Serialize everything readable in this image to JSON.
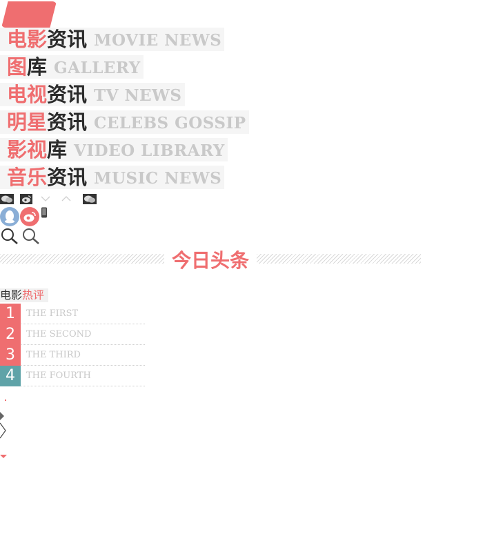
{
  "colors": {
    "accent": "#ef6e70",
    "dark": "#2a2a2a",
    "muted": "#c9c9c9",
    "teal": "#5fa3a8"
  },
  "nav": [
    {
      "cn_red": "电影",
      "cn_dark": "资讯",
      "en": "MOVIE NEWS"
    },
    {
      "cn_red": "图",
      "cn_dark": "库",
      "en": "GALLERY"
    },
    {
      "cn_red": "电视",
      "cn_dark": "资讯",
      "en": "TV NEWS"
    },
    {
      "cn_red": "明星",
      "cn_dark": "资讯",
      "en": "CELEBS GOSSIP"
    },
    {
      "cn_red": "影视",
      "cn_dark": "库",
      "en": "VIDEO LIBRARY"
    },
    {
      "cn_red": "音乐",
      "cn_dark": "资讯",
      "en": "MUSIC NEWS"
    }
  ],
  "icons_row1": [
    "wechat-icon",
    "weibo-icon",
    "chevron-down-icon",
    "chevron-up-icon",
    "wechat-icon"
  ],
  "icons_row2": [
    "qq-icon",
    "weibo-icon",
    "mobile-icon"
  ],
  "icons_row3": [
    "search-icon",
    "search-icon"
  ],
  "headline": {
    "title": "今日头条"
  },
  "hot_reviews": {
    "title_a": "电影",
    "title_b": "热评",
    "items": [
      {
        "rank": "1",
        "text": "THE FIRST",
        "color": "#ef6e70"
      },
      {
        "rank": "2",
        "text": "THE SECOND",
        "color": "#ef6e70"
      },
      {
        "rank": "3",
        "text": "THE THIRD",
        "color": "#ef6e70"
      },
      {
        "rank": "4",
        "text": "THE FOURTH",
        "color": "#5fa3a8"
      }
    ]
  },
  "misc_icons": [
    "dot-icon",
    "diamond-icon",
    "chevron-right-icon",
    "caret-down-icon"
  ]
}
